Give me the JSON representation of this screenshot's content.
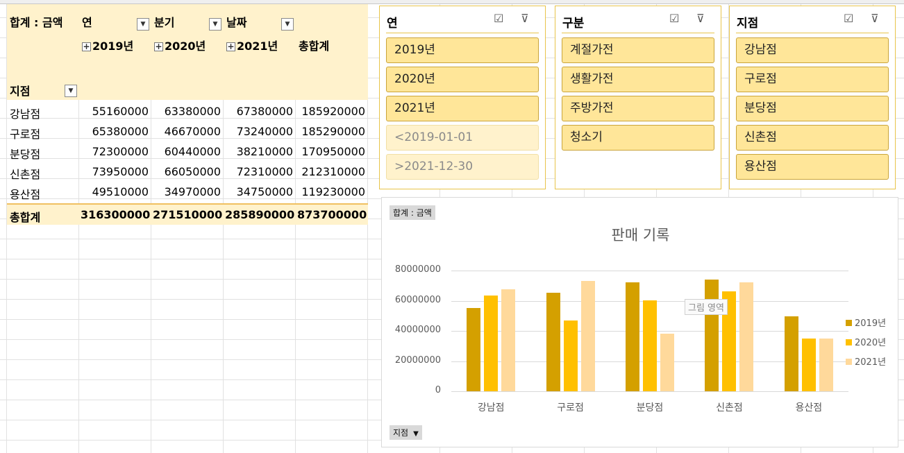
{
  "pivot": {
    "header": {
      "sum_label": "합계 : 금액",
      "year_label": "연",
      "quarter_label": "분기",
      "date_label": "날짜",
      "years": [
        "2019년",
        "2020년",
        "2021년"
      ],
      "grand_total_label": "총합계",
      "row_field_label": "지점"
    },
    "rows": [
      {
        "branch": "강남점",
        "y2019": "55160000",
        "y2020": "63380000",
        "y2021": "67380000",
        "total": "185920000"
      },
      {
        "branch": "구로점",
        "y2019": "65380000",
        "y2020": "46670000",
        "y2021": "73240000",
        "total": "185290000"
      },
      {
        "branch": "분당점",
        "y2019": "72300000",
        "y2020": "60440000",
        "y2021": "38210000",
        "total": "170950000"
      },
      {
        "branch": "신촌점",
        "y2019": "73950000",
        "y2020": "66050000",
        "y2021": "72310000",
        "total": "212310000"
      },
      {
        "branch": "용산점",
        "y2019": "49510000",
        "y2020": "34970000",
        "y2021": "34750000",
        "total": "119230000"
      }
    ],
    "grand_total": {
      "label": "총합계",
      "y2019": "316300000",
      "y2020": "271510000",
      "y2021": "285890000",
      "total": "873700000"
    }
  },
  "slicers": [
    {
      "title": "연",
      "items": [
        {
          "label": "2019년",
          "selected": true
        },
        {
          "label": "2020년",
          "selected": true
        },
        {
          "label": "2021년",
          "selected": true
        },
        {
          "label": "<2019-01-01",
          "selected": false
        },
        {
          "label": ">2021-12-30",
          "selected": false
        }
      ]
    },
    {
      "title": "구분",
      "items": [
        {
          "label": "계절가전",
          "selected": true
        },
        {
          "label": "생활가전",
          "selected": true
        },
        {
          "label": "주방가전",
          "selected": true
        },
        {
          "label": "청소기",
          "selected": true
        }
      ]
    },
    {
      "title": "지점",
      "items": [
        {
          "label": "강남점",
          "selected": true
        },
        {
          "label": "구로점",
          "selected": true
        },
        {
          "label": "분당점",
          "selected": true
        },
        {
          "label": "신촌점",
          "selected": true
        },
        {
          "label": "용산점",
          "selected": true
        }
      ]
    }
  ],
  "chart_field_buttons": {
    "value": "합계 : 금액",
    "axis": "지점"
  },
  "chart_tooltip": "그림 영역",
  "chart_data": {
    "type": "bar",
    "title": "판매 기록",
    "categories": [
      "강남점",
      "구로점",
      "분당점",
      "신촌점",
      "용산점"
    ],
    "series": [
      {
        "name": "2019년",
        "color": "#d4a000",
        "values": [
          55160000,
          65380000,
          72300000,
          73950000,
          49510000
        ]
      },
      {
        "name": "2020년",
        "color": "#ffc000",
        "values": [
          63380000,
          46670000,
          60440000,
          66050000,
          34970000
        ]
      },
      {
        "name": "2021년",
        "color": "#ffd99b",
        "values": [
          67380000,
          73240000,
          38210000,
          72310000,
          34750000
        ]
      }
    ],
    "yticks": [
      "0",
      "20000000",
      "40000000",
      "60000000",
      "80000000"
    ],
    "ylim": [
      0,
      80000000
    ],
    "legend": "right",
    "grid": true
  }
}
